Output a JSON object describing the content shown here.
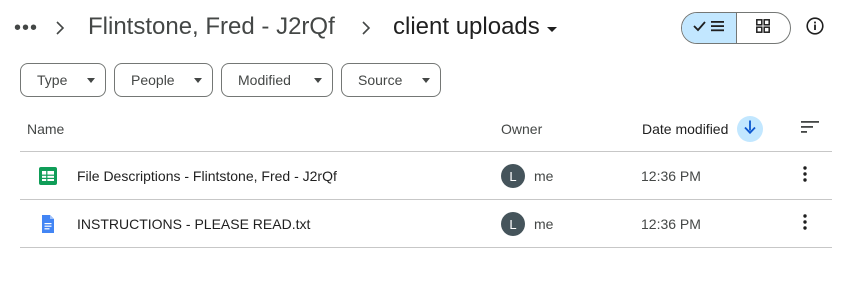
{
  "breadcrumb": {
    "more_label": "•••",
    "parent": "Flintstone, Fred - J2rQf",
    "current": "client uploads"
  },
  "view": {
    "mode": "list",
    "list_icon": "check-list-icon",
    "grid_icon": "grid-icon"
  },
  "filters": [
    {
      "label": "Type"
    },
    {
      "label": "People"
    },
    {
      "label": "Modified"
    },
    {
      "label": "Source"
    }
  ],
  "columns": {
    "name": "Name",
    "owner": "Owner",
    "modified": "Date modified",
    "sort_direction": "descending"
  },
  "files": [
    {
      "name": "File Descriptions - Flintstone, Fred - J2rQf",
      "type": "spreadsheet",
      "owner_initial": "L",
      "owner": "me",
      "modified": "12:36 PM"
    },
    {
      "name": "INSTRUCTIONS - PLEASE READ.txt",
      "type": "document",
      "owner_initial": "L",
      "owner": "me",
      "modified": "12:36 PM"
    }
  ],
  "colors": {
    "accent_light": "#c2e7ff",
    "sheets_green": "#0f9d58",
    "docs_blue": "#4285f4",
    "avatar": "#45545b"
  }
}
